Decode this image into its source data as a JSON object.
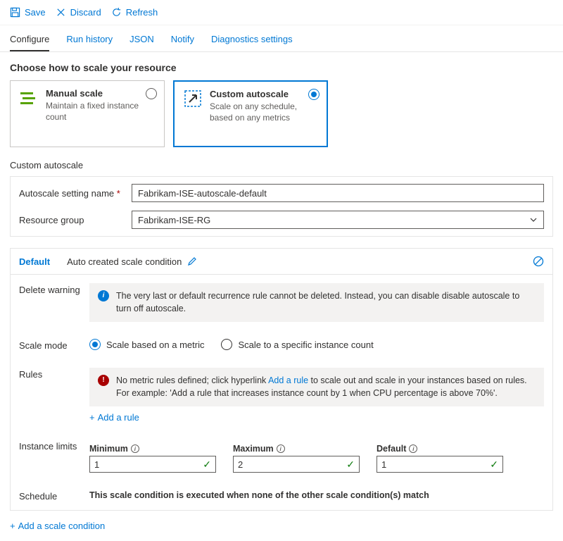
{
  "toolbar": {
    "save": "Save",
    "discard": "Discard",
    "refresh": "Refresh"
  },
  "tabs": {
    "items": [
      {
        "label": "Configure",
        "active": true
      },
      {
        "label": "Run history"
      },
      {
        "label": "JSON"
      },
      {
        "label": "Notify"
      },
      {
        "label": "Diagnostics settings"
      }
    ]
  },
  "section_title": "Choose how to scale your resource",
  "cards": {
    "manual": {
      "title": "Manual scale",
      "sub": "Maintain a fixed instance count"
    },
    "custom": {
      "title": "Custom autoscale",
      "sub": "Scale on any schedule, based on any metrics"
    }
  },
  "sub_heading": "Custom autoscale",
  "form": {
    "name_label": "Autoscale setting name",
    "name_value": "Fabrikam-ISE-autoscale-default",
    "rg_label": "Resource group",
    "rg_value": "Fabrikam-ISE-RG"
  },
  "condition": {
    "name": "Default",
    "label": "Auto created scale condition",
    "delete_warning_label": "Delete warning",
    "delete_warning_text": "The very last or default recurrence rule cannot be deleted. Instead, you can disable disable autoscale to turn off autoscale.",
    "scale_mode_label": "Scale mode",
    "mode_metric": "Scale based on a metric",
    "mode_count": "Scale to a specific instance count",
    "rules_label": "Rules",
    "rules_text_pre": "No metric rules defined; click hyperlink ",
    "rules_link": "Add a rule",
    "rules_text_post": " to scale out and scale in your instances based on rules. For example: 'Add a rule that increases instance count by 1 when CPU percentage is above 70%'.",
    "add_rule": "Add a rule",
    "limits_label": "Instance limits",
    "limits": {
      "min_label": "Minimum",
      "min_value": "1",
      "max_label": "Maximum",
      "max_value": "2",
      "def_label": "Default",
      "def_value": "1"
    },
    "schedule_label": "Schedule",
    "schedule_text": "This scale condition is executed when none of the other scale condition(s) match"
  },
  "add_condition": "Add a scale condition"
}
